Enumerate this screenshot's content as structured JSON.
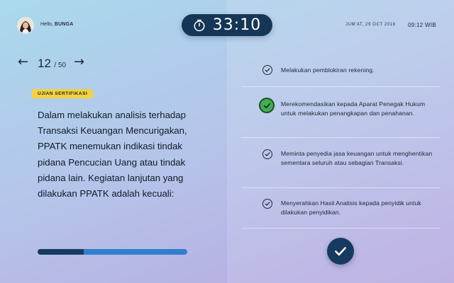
{
  "header": {
    "greeting_prefix": "Hello,",
    "user_name": "BUNGA",
    "timer": "33:10",
    "date": "JUM'AT, 29 OCT 2018",
    "time": "09:12 WIB"
  },
  "question_nav": {
    "prev_symbol": "←",
    "next_symbol": "→",
    "current": "12",
    "total": "/ 50"
  },
  "badge": "UJIAN SERTIFIKASI",
  "question_text": "Dalam melakukan analisis terhadap Transaksi Keuangan Mencurigakan, PPATK menemukan indikasi tindak pidana Pencucian Uang atau tindak pidana lain.  Kegiatan lanjutan yang dilakukan PPATK adalah kecuali:",
  "progress": {
    "fraction": 0.31
  },
  "options": [
    {
      "text": "Melakukan pemblokiran rekening.",
      "selected": false
    },
    {
      "text": "Merekomendasikan kepada Aparat Penegak Hukum untuk melakukan penangkapan dan penahanan.",
      "selected": true
    },
    {
      "text": "Meminta penyedia jasa keuangan untuk menghentikan sementara seluruh atau sebagian Transaksi.",
      "selected": false
    },
    {
      "text": "Menyerahkan Hasil Analisis kepada penyidik untuk dilakukan penyidikan.",
      "selected": false
    }
  ],
  "colors": {
    "accent_dark": "#173a60",
    "accent_blue": "#2f7fcd",
    "selected_green": "#3fae56",
    "badge_yellow": "#f4d23d"
  },
  "icons": {
    "timer": "stopwatch-icon",
    "option": "check-circle-icon",
    "submit": "check-icon"
  }
}
